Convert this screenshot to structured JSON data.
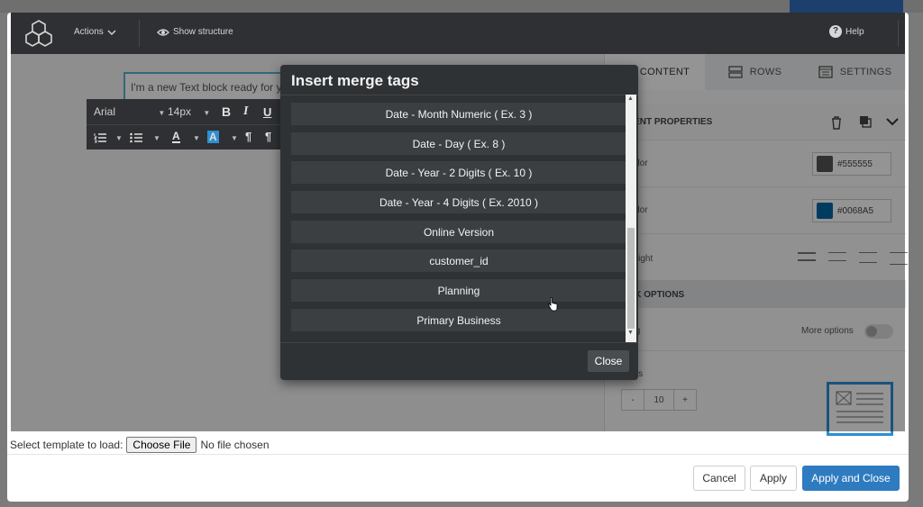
{
  "editor_toolbar": {
    "actions_label": "Actions",
    "show_structure_label": "Show structure",
    "help_label": "Help"
  },
  "canvas": {
    "text_block": "I'm a new Text block ready for yo"
  },
  "text_toolbar": {
    "font": "Arial",
    "size": "14px"
  },
  "right_panel": {
    "tabs": [
      "CONTENT",
      "ROWS",
      "SETTINGS"
    ],
    "content_properties_label": "TENT PROPERTIES",
    "row1_label": "color",
    "row1_value": "#555555",
    "row2_label": "color",
    "row2_value": "#0068A5",
    "row3_label": "height",
    "block_options_label": "CK OPTIONS",
    "row4_label": "ing",
    "more_options_label": "More options",
    "row5_label": "des",
    "stepper_minus": "-",
    "stepper_value": "10",
    "stepper_plus": "+"
  },
  "merge_dialog": {
    "title": "Insert merge tags",
    "items": [
      "Date - Month Numeric ( Ex. 3 )",
      "Date - Day ( Ex. 8 )",
      "Date - Year - 2 Digits ( Ex. 10 )",
      "Date - Year - 4 Digits ( Ex. 2010 )",
      "Online Version",
      "customer_id",
      "Planning",
      "Primary Business"
    ],
    "close_label": "Close"
  },
  "file_row": {
    "label": "Select template to load:",
    "button_label": "Choose File",
    "status": "No file chosen"
  },
  "footer": {
    "cancel_label": "Cancel",
    "apply_label": "Apply",
    "apply_close_label": "Apply and Close"
  },
  "colors": {
    "accent": "#2f7bc0",
    "swatch_1": "#555555",
    "swatch_2": "#0068A5"
  }
}
